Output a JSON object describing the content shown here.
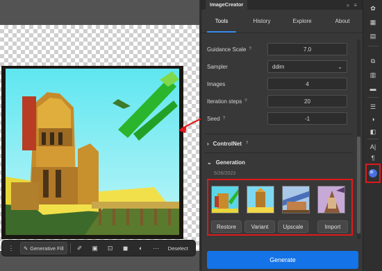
{
  "panel": {
    "title": "ImageCreator",
    "tabs": [
      {
        "label": "Tools"
      },
      {
        "label": "History"
      },
      {
        "label": "Explore"
      },
      {
        "label": "About"
      }
    ],
    "params": [
      {
        "label": "Guidance Scale",
        "value": "7.0"
      },
      {
        "label": "Sampler",
        "value": "ddim"
      },
      {
        "label": "Images",
        "value": "4"
      },
      {
        "label": "Iteration steps",
        "value": "20"
      },
      {
        "label": "Seed",
        "value": "-1"
      }
    ],
    "help_glyph": "?",
    "controlnet_label": "ControlNet",
    "generation_label": "Generation",
    "generation_date": "5/26/2023",
    "buttons": {
      "restore": "Restore",
      "variant": "Variant",
      "upscale": "Upscale",
      "import": "Import"
    },
    "generate_label": "Generate"
  },
  "context_bar": {
    "generative_fill": "Generative Fill",
    "deselect": "Deselect"
  },
  "colors": {
    "accent": "#1473e6",
    "highlight": "#e0191b",
    "panel_bg": "#383838"
  },
  "icons": {
    "right_toolbar": [
      "brush-settings-icon",
      "grid-icon",
      "layers-icon",
      "adjust-icon",
      "paragraph-style-icon",
      "comment-icon",
      "properties-icon",
      "color-icon",
      "libraries-icon",
      "character-icon",
      "paragraph-icon",
      "plugin-icon"
    ]
  }
}
